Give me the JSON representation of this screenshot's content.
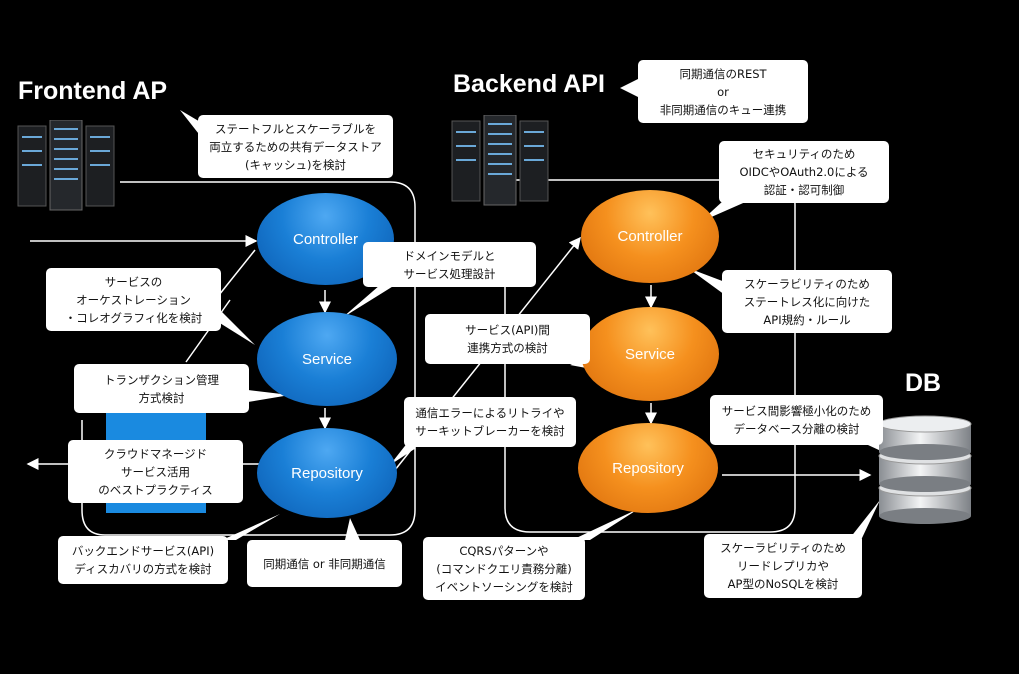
{
  "titles": {
    "frontend": "Frontend AP",
    "backend": "Backend API",
    "db": "DB"
  },
  "frontend_nodes": {
    "controller": "Controller",
    "service": "Service",
    "repository": "Repository"
  },
  "backend_nodes": {
    "controller": "Controller",
    "service": "Service",
    "repository": "Repository"
  },
  "notes": {
    "backend_comm": [
      "同期通信のREST",
      "or",
      "非同期通信のキュー連携"
    ],
    "fe_cache": [
      "ステートフルとスケーラブルを",
      "両立するための共有データストア",
      "(キャッシュ)を検討"
    ],
    "security": [
      "セキュリティのため",
      "OIDCやOAuth2.0による",
      "認証・認可制御"
    ],
    "domain_model": [
      "ドメインモデルと",
      "サービス処理設計"
    ],
    "orchestration": [
      "サービスの",
      "オーケストレーション",
      "・コレオグラフィ化を検討"
    ],
    "stateless": [
      "スケーラビリティのため",
      "ステートレス化に向けた",
      "API規約・ルール"
    ],
    "api_integration": [
      "サービス(API)間",
      "連携方式の検討"
    ],
    "transaction": [
      "トランザクション管理",
      "方式検討"
    ],
    "retry": [
      "通信エラーによるリトライや",
      "サーキットブレーカーを検討"
    ],
    "db_split": [
      "サービス間影響極小化のため",
      "データベース分離の検討"
    ],
    "managed": [
      "クラウドマネージド",
      "サービス活用",
      "のベストプラクティス"
    ],
    "discovery": [
      "バックエンドサービス(API)",
      "ディスカバリの方式を検討"
    ],
    "sync_async": [
      "同期通信 or 非同期通信"
    ],
    "cqrs": [
      "CQRSパターンや",
      "(コマンドクエリ責務分離)",
      "イベントソーシングを検討"
    ],
    "read_replica": [
      "スケーラビリティのため",
      "リードレプリカや",
      "AP型のNoSQLを検討"
    ]
  },
  "colors": {
    "background": "#000000",
    "frontend_node": "#1a7fd6",
    "backend_node": "#f5901e",
    "note": "#ffffff"
  }
}
